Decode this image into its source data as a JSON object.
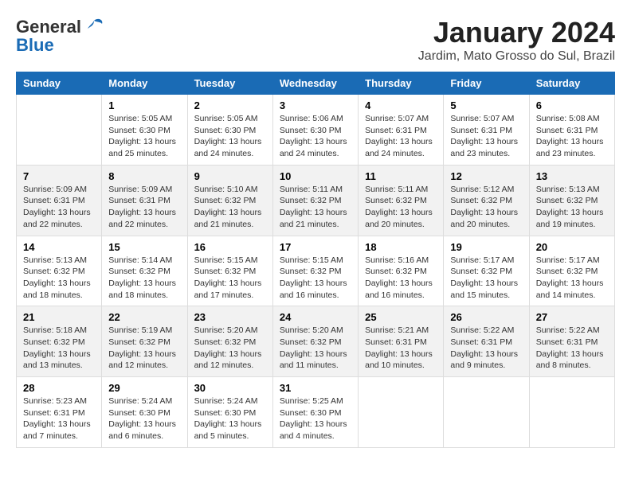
{
  "header": {
    "logo_line1": "General",
    "logo_line2": "Blue",
    "month": "January 2024",
    "location": "Jardim, Mato Grosso do Sul, Brazil"
  },
  "weekdays": [
    "Sunday",
    "Monday",
    "Tuesday",
    "Wednesday",
    "Thursday",
    "Friday",
    "Saturday"
  ],
  "weeks": [
    [
      {
        "day": "",
        "info": ""
      },
      {
        "day": "1",
        "info": "Sunrise: 5:05 AM\nSunset: 6:30 PM\nDaylight: 13 hours\nand 25 minutes."
      },
      {
        "day": "2",
        "info": "Sunrise: 5:05 AM\nSunset: 6:30 PM\nDaylight: 13 hours\nand 24 minutes."
      },
      {
        "day": "3",
        "info": "Sunrise: 5:06 AM\nSunset: 6:30 PM\nDaylight: 13 hours\nand 24 minutes."
      },
      {
        "day": "4",
        "info": "Sunrise: 5:07 AM\nSunset: 6:31 PM\nDaylight: 13 hours\nand 24 minutes."
      },
      {
        "day": "5",
        "info": "Sunrise: 5:07 AM\nSunset: 6:31 PM\nDaylight: 13 hours\nand 23 minutes."
      },
      {
        "day": "6",
        "info": "Sunrise: 5:08 AM\nSunset: 6:31 PM\nDaylight: 13 hours\nand 23 minutes."
      }
    ],
    [
      {
        "day": "7",
        "info": "Sunrise: 5:09 AM\nSunset: 6:31 PM\nDaylight: 13 hours\nand 22 minutes."
      },
      {
        "day": "8",
        "info": "Sunrise: 5:09 AM\nSunset: 6:31 PM\nDaylight: 13 hours\nand 22 minutes."
      },
      {
        "day": "9",
        "info": "Sunrise: 5:10 AM\nSunset: 6:32 PM\nDaylight: 13 hours\nand 21 minutes."
      },
      {
        "day": "10",
        "info": "Sunrise: 5:11 AM\nSunset: 6:32 PM\nDaylight: 13 hours\nand 21 minutes."
      },
      {
        "day": "11",
        "info": "Sunrise: 5:11 AM\nSunset: 6:32 PM\nDaylight: 13 hours\nand 20 minutes."
      },
      {
        "day": "12",
        "info": "Sunrise: 5:12 AM\nSunset: 6:32 PM\nDaylight: 13 hours\nand 20 minutes."
      },
      {
        "day": "13",
        "info": "Sunrise: 5:13 AM\nSunset: 6:32 PM\nDaylight: 13 hours\nand 19 minutes."
      }
    ],
    [
      {
        "day": "14",
        "info": "Sunrise: 5:13 AM\nSunset: 6:32 PM\nDaylight: 13 hours\nand 18 minutes."
      },
      {
        "day": "15",
        "info": "Sunrise: 5:14 AM\nSunset: 6:32 PM\nDaylight: 13 hours\nand 18 minutes."
      },
      {
        "day": "16",
        "info": "Sunrise: 5:15 AM\nSunset: 6:32 PM\nDaylight: 13 hours\nand 17 minutes."
      },
      {
        "day": "17",
        "info": "Sunrise: 5:15 AM\nSunset: 6:32 PM\nDaylight: 13 hours\nand 16 minutes."
      },
      {
        "day": "18",
        "info": "Sunrise: 5:16 AM\nSunset: 6:32 PM\nDaylight: 13 hours\nand 16 minutes."
      },
      {
        "day": "19",
        "info": "Sunrise: 5:17 AM\nSunset: 6:32 PM\nDaylight: 13 hours\nand 15 minutes."
      },
      {
        "day": "20",
        "info": "Sunrise: 5:17 AM\nSunset: 6:32 PM\nDaylight: 13 hours\nand 14 minutes."
      }
    ],
    [
      {
        "day": "21",
        "info": "Sunrise: 5:18 AM\nSunset: 6:32 PM\nDaylight: 13 hours\nand 13 minutes."
      },
      {
        "day": "22",
        "info": "Sunrise: 5:19 AM\nSunset: 6:32 PM\nDaylight: 13 hours\nand 12 minutes."
      },
      {
        "day": "23",
        "info": "Sunrise: 5:20 AM\nSunset: 6:32 PM\nDaylight: 13 hours\nand 12 minutes."
      },
      {
        "day": "24",
        "info": "Sunrise: 5:20 AM\nSunset: 6:32 PM\nDaylight: 13 hours\nand 11 minutes."
      },
      {
        "day": "25",
        "info": "Sunrise: 5:21 AM\nSunset: 6:31 PM\nDaylight: 13 hours\nand 10 minutes."
      },
      {
        "day": "26",
        "info": "Sunrise: 5:22 AM\nSunset: 6:31 PM\nDaylight: 13 hours\nand 9 minutes."
      },
      {
        "day": "27",
        "info": "Sunrise: 5:22 AM\nSunset: 6:31 PM\nDaylight: 13 hours\nand 8 minutes."
      }
    ],
    [
      {
        "day": "28",
        "info": "Sunrise: 5:23 AM\nSunset: 6:31 PM\nDaylight: 13 hours\nand 7 minutes."
      },
      {
        "day": "29",
        "info": "Sunrise: 5:24 AM\nSunset: 6:30 PM\nDaylight: 13 hours\nand 6 minutes."
      },
      {
        "day": "30",
        "info": "Sunrise: 5:24 AM\nSunset: 6:30 PM\nDaylight: 13 hours\nand 5 minutes."
      },
      {
        "day": "31",
        "info": "Sunrise: 5:25 AM\nSunset: 6:30 PM\nDaylight: 13 hours\nand 4 minutes."
      },
      {
        "day": "",
        "info": ""
      },
      {
        "day": "",
        "info": ""
      },
      {
        "day": "",
        "info": ""
      }
    ]
  ]
}
